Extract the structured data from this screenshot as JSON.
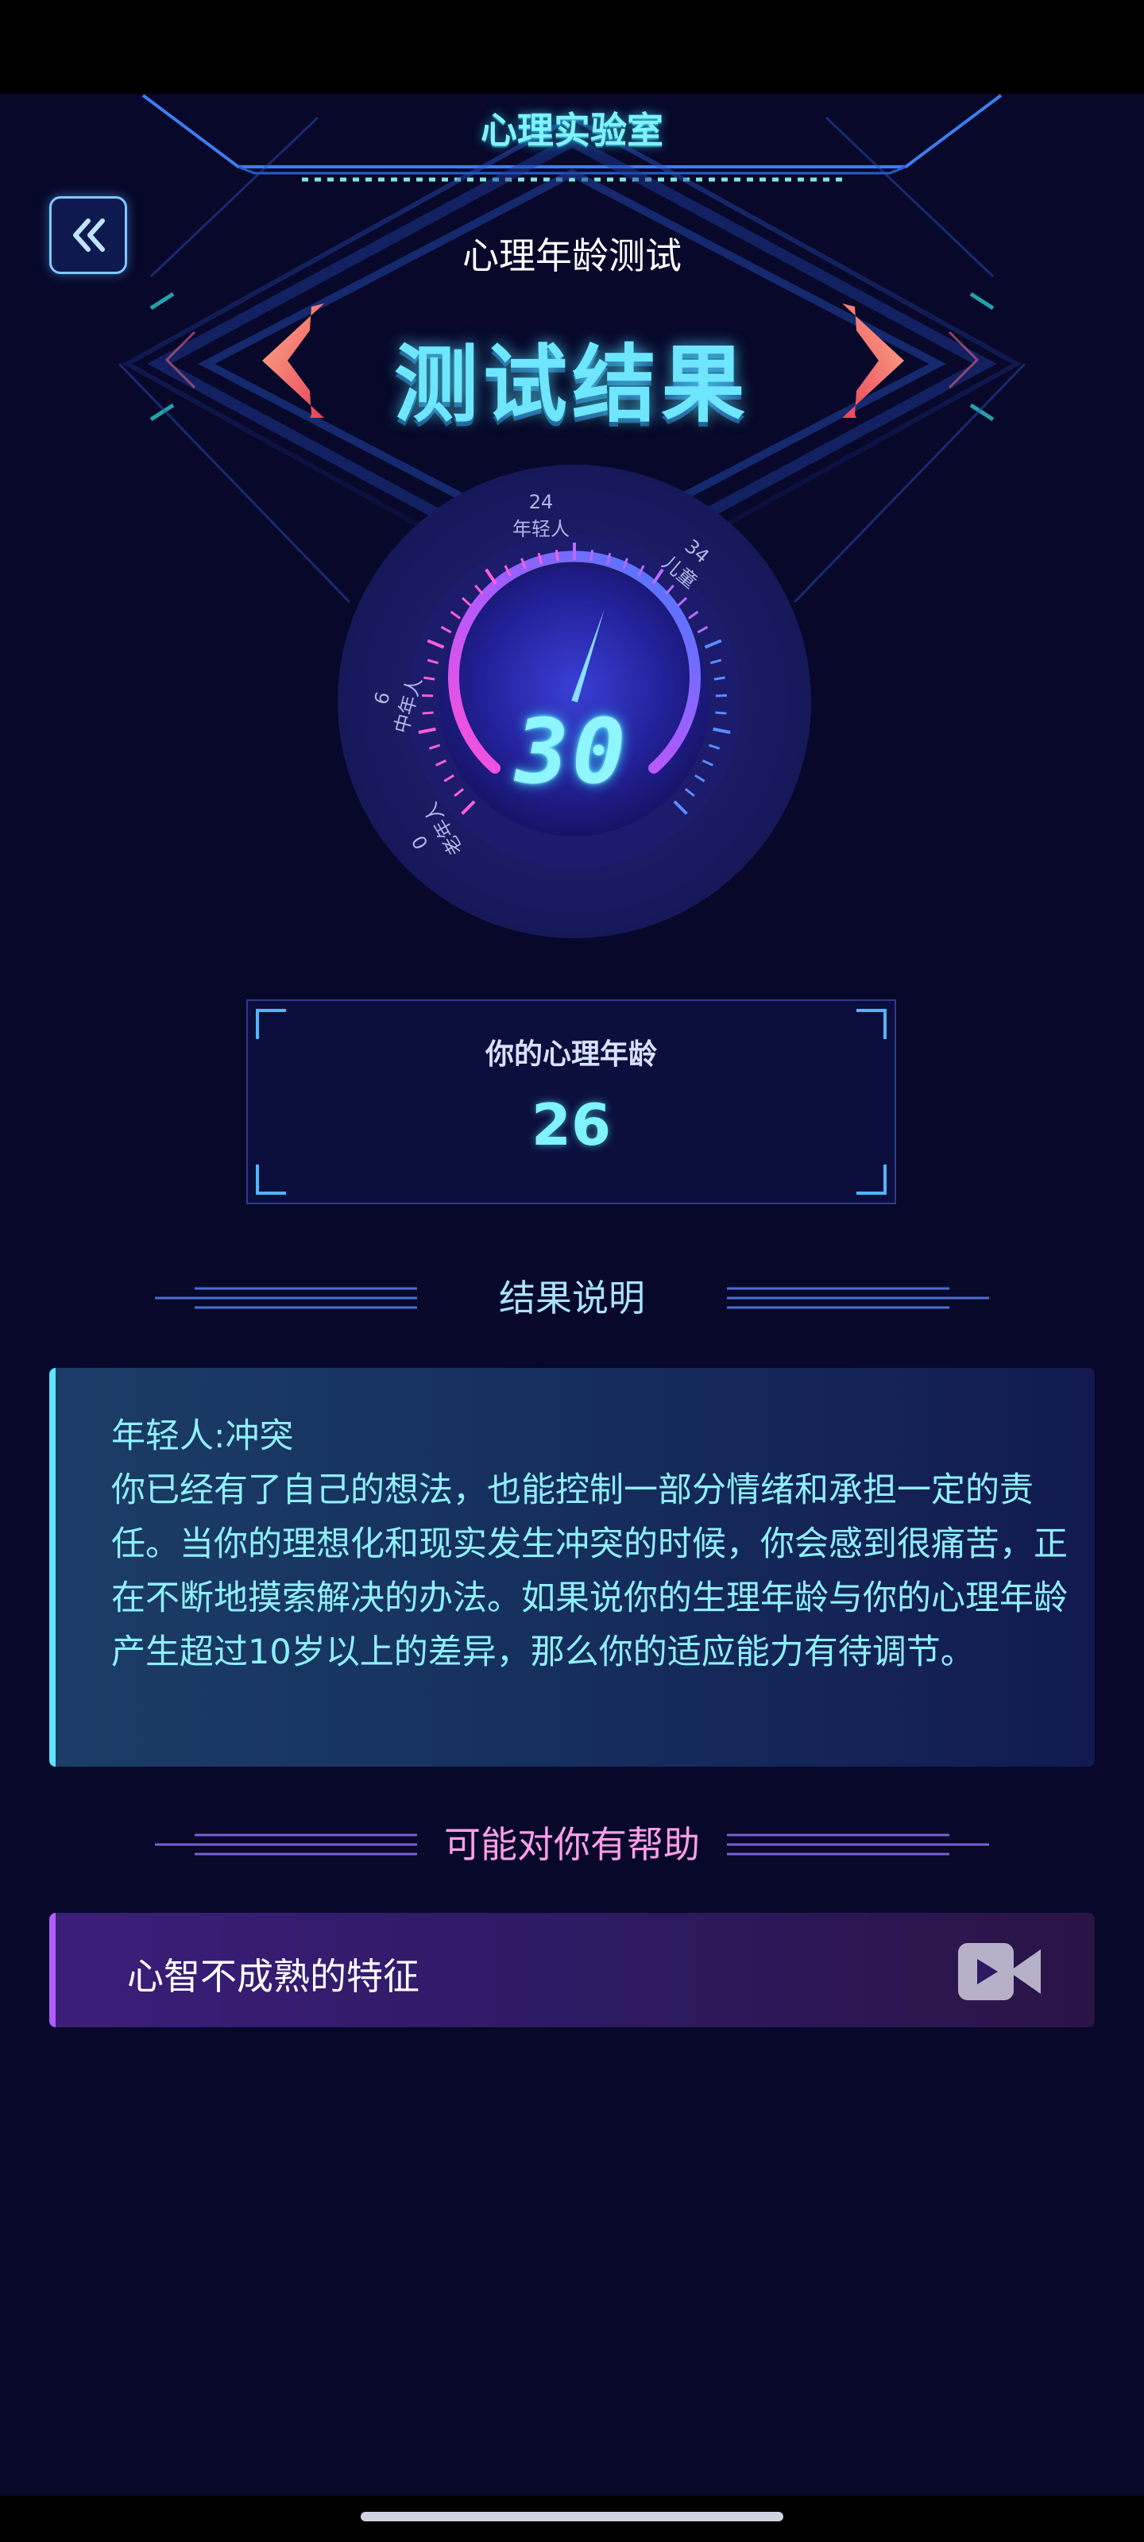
{
  "header": {
    "lab_title": "心理实验室",
    "subtitle": "心理年龄测试",
    "result_title": "测试结果"
  },
  "gauge": {
    "value": "30",
    "needle_age": 30,
    "ticks": [
      {
        "age": "0",
        "group": "老年人"
      },
      {
        "age": "6",
        "group": "中年人"
      },
      {
        "age": "24",
        "group": "年轻人"
      },
      {
        "age": "34",
        "group": "儿童"
      }
    ]
  },
  "age_result": {
    "label": "你的心理年龄",
    "value": "26"
  },
  "explanation": {
    "header": "结果说明",
    "title": "年轻人:冲突",
    "body": "你已经有了自己的想法，也能控制一部分情绪和承担一定的责任。当你的理想化和现实发生冲突的时候，你会感到很痛苦，正在不断地摸索解决的办法。如果说你的生理年龄与你的心理年龄产生超过10岁以上的差异，那么你的适应能力有待调节。"
  },
  "help": {
    "header": "可能对你有帮助",
    "items": [
      {
        "label": "心智不成熟的特征",
        "icon": "video-camera-icon"
      }
    ]
  },
  "colors": {
    "background": "#07082a",
    "accent_cyan": "#7ff3ff",
    "accent_pink": "#ff8fe8",
    "arrow_orange": "#ff7a5a"
  }
}
